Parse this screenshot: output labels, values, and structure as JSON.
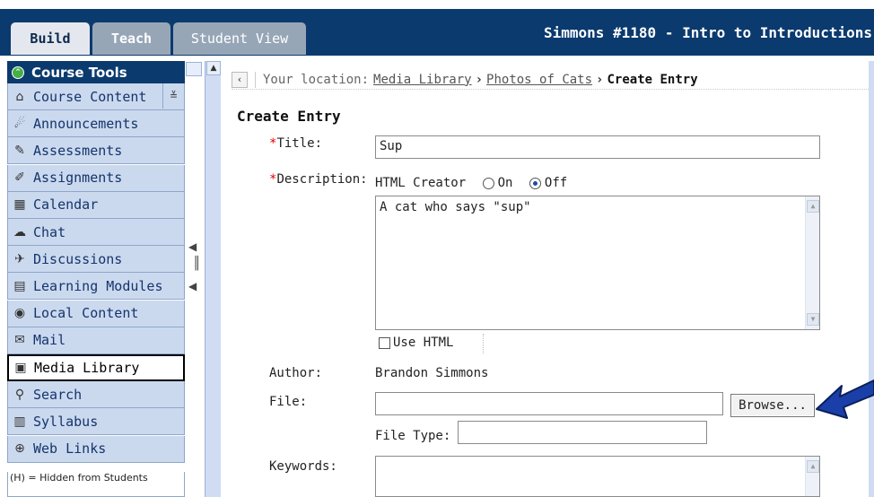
{
  "tabs": {
    "build": "Build",
    "teach": "Teach",
    "student_view": "Student View"
  },
  "course_title": "Simmons #1180 - Intro to Introductions",
  "sidebar": {
    "header": "Course Tools",
    "items": [
      {
        "label": "Course Content",
        "icon": "course-content-icon",
        "glyph": "⌂"
      },
      {
        "label": "Announcements",
        "icon": "announcements-icon",
        "glyph": "☄"
      },
      {
        "label": "Assessments",
        "icon": "assessments-icon",
        "glyph": "✎"
      },
      {
        "label": "Assignments",
        "icon": "assignments-icon",
        "glyph": "✐"
      },
      {
        "label": "Calendar",
        "icon": "calendar-icon",
        "glyph": "▦"
      },
      {
        "label": "Chat",
        "icon": "chat-icon",
        "glyph": "☁"
      },
      {
        "label": "Discussions",
        "icon": "discussions-icon",
        "glyph": "✈"
      },
      {
        "label": "Learning Modules",
        "icon": "learning-modules-icon",
        "glyph": "▤"
      },
      {
        "label": "Local Content",
        "icon": "local-content-icon",
        "glyph": "◉"
      },
      {
        "label": "Mail",
        "icon": "mail-icon",
        "glyph": "✉"
      },
      {
        "label": "Media Library",
        "icon": "media-library-icon",
        "glyph": "▣"
      },
      {
        "label": "Search",
        "icon": "search-icon",
        "glyph": "⚲"
      },
      {
        "label": "Syllabus",
        "icon": "syllabus-icon",
        "glyph": "▥"
      },
      {
        "label": "Web Links",
        "icon": "web-links-icon",
        "glyph": "⊕"
      }
    ],
    "active_index": 10,
    "hidden_note": "(H) = Hidden from Students"
  },
  "breadcrumb": {
    "prefix": "Your location:",
    "links": [
      "Media Library",
      "Photos of Cats"
    ],
    "current": "Create Entry"
  },
  "form": {
    "title": "Create Entry",
    "title_label": "Title:",
    "title_value": "Sup",
    "description_label": "Description:",
    "html_creator_label": "HTML Creator",
    "on_label": "On",
    "off_label": "Off",
    "html_creator_selected": "Off",
    "description_value": "A cat who says \"sup\"",
    "use_html_label": "Use HTML",
    "author_label": "Author:",
    "author_value": "Brandon Simmons",
    "file_label": "File:",
    "file_value": "",
    "browse_label": "Browse...",
    "file_type_label": "File Type:",
    "file_type_value": "",
    "keywords_label": "Keywords:",
    "keywords_value": ""
  },
  "colors": {
    "top_bar": "#0b3a6e",
    "sidebar_item_bg": "#cbd9ef",
    "required": "#dd0000",
    "annotation_arrow": "#1b3fa8"
  }
}
